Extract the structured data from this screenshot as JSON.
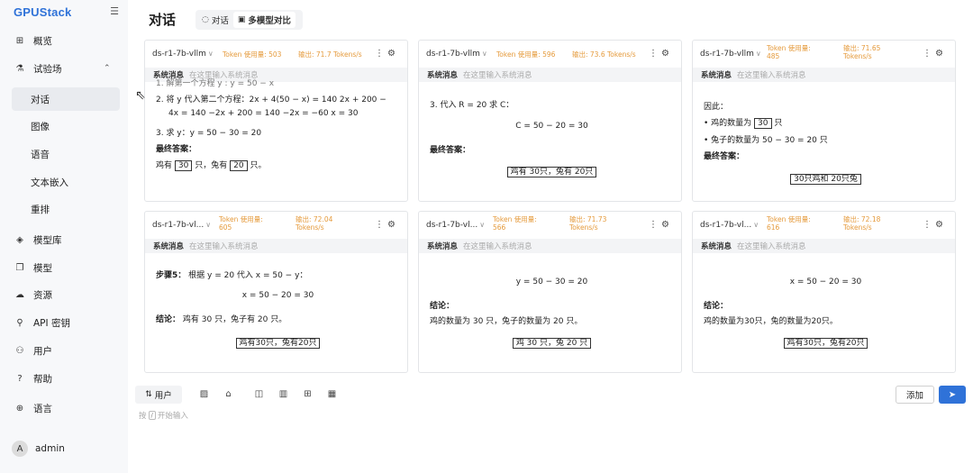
{
  "sidebar": {
    "brand": "GPUStack",
    "collapse_icon": "menu-fold-icon",
    "items": [
      {
        "label": "概览",
        "icon": "dashboard-icon"
      },
      {
        "label": "试验场",
        "icon": "flask-icon"
      },
      {
        "label": "对话"
      },
      {
        "label": "图像"
      },
      {
        "label": "语音"
      },
      {
        "label": "文本嵌入"
      },
      {
        "label": "重排"
      },
      {
        "label": "模型库",
        "icon": "cube-icon"
      },
      {
        "label": "模型",
        "icon": "copy-icon"
      },
      {
        "label": "资源",
        "icon": "cloud-icon"
      },
      {
        "label": "API 密钥",
        "icon": "key-icon"
      },
      {
        "label": "用户",
        "icon": "users-icon"
      },
      {
        "label": "帮助",
        "icon": "question-icon"
      },
      {
        "label": "语言",
        "icon": "globe-icon"
      }
    ],
    "user": {
      "avatar": "A",
      "name": "admin"
    }
  },
  "header": {
    "title": "对话",
    "tabs": [
      {
        "label": "对话",
        "icon": "chat-icon"
      },
      {
        "label": "多模型对比",
        "icon": "compare-icon"
      }
    ]
  },
  "system_label": "系统消息",
  "system_placeholder": "在这里输入系统消息",
  "panels": [
    {
      "model": "ds-r1-7b-vllm",
      "token": "Token 使用量: 503",
      "output": "输出: 71.7 Tokens/s",
      "lines": [
        "1. 解第一个方程 y : y = 50 − x",
        "2. 将 y 代入第二个方程：2x + 4(50 − x) = 140 2x + 200 −",
        "4x = 140 −2x + 200 = 140 −2x = −60 x = 30",
        "3. 求 y：y = 50 − 30 = 20",
        "最终答案：",
        "鸡有",
        "30",
        "只，兔有",
        "20",
        "只。"
      ]
    },
    {
      "model": "ds-r1-7b-vllm",
      "token": "Token 使用量: 596",
      "output": "输出: 73.6 Tokens/s",
      "lines": [
        "3. 代入 R = 20 求 C：",
        "C = 50 − 20 = 30",
        "最终答案：",
        "鸡有 30只，兔有 20只"
      ]
    },
    {
      "model": "ds-r1-7b-vllm",
      "token": "Token 使用量: 485",
      "output": "输出: 71.65 Tokens/s",
      "lines": [
        "因此：",
        "• 鸡的数量为",
        "30",
        "只",
        "• 兔子的数量为 50 − 30 = 20 只",
        "最终答案：",
        "30只鸡和 20只兔"
      ]
    },
    {
      "model": "ds-r1-7b-vl...",
      "token": "Token 使用量: 605",
      "output": "输出: 72.04 Tokens/s",
      "lines": [
        "步骤5：",
        "根据 y = 20 代入 x = 50 − y：",
        "x = 50 − 20 = 30",
        "结论：",
        "鸡有 30 只，兔子有 20 只。",
        "鸡有30只，兔有20只"
      ]
    },
    {
      "model": "ds-r1-7b-vl...",
      "token": "Token 使用量: 566",
      "output": "输出: 71.73 Tokens/s",
      "lines": [
        "y = 50 − 30 = 20",
        "结论：",
        "鸡的数量为 30 只，兔子的数量为 20 只。",
        "鸡 30 只，兔 20 只"
      ]
    },
    {
      "model": "ds-r1-7b-vl...",
      "token": "Token 使用量: 616",
      "output": "输出: 72.18 Tokens/s",
      "lines": [
        "x = 50 − 20 = 30",
        "结论：",
        "鸡的数量为30只，兔的数量为20只。",
        "鸡有30只，兔有20只"
      ]
    }
  ],
  "footer": {
    "role": "用户",
    "hint_prefix": "按",
    "hint_key": "/",
    "hint_suffix": "开始输入",
    "add": "添加",
    "tools": [
      "image-icon",
      "home-icon",
      "layout-1-icon",
      "layout-2-icon",
      "layout-3-icon",
      "layout-4-icon"
    ]
  }
}
